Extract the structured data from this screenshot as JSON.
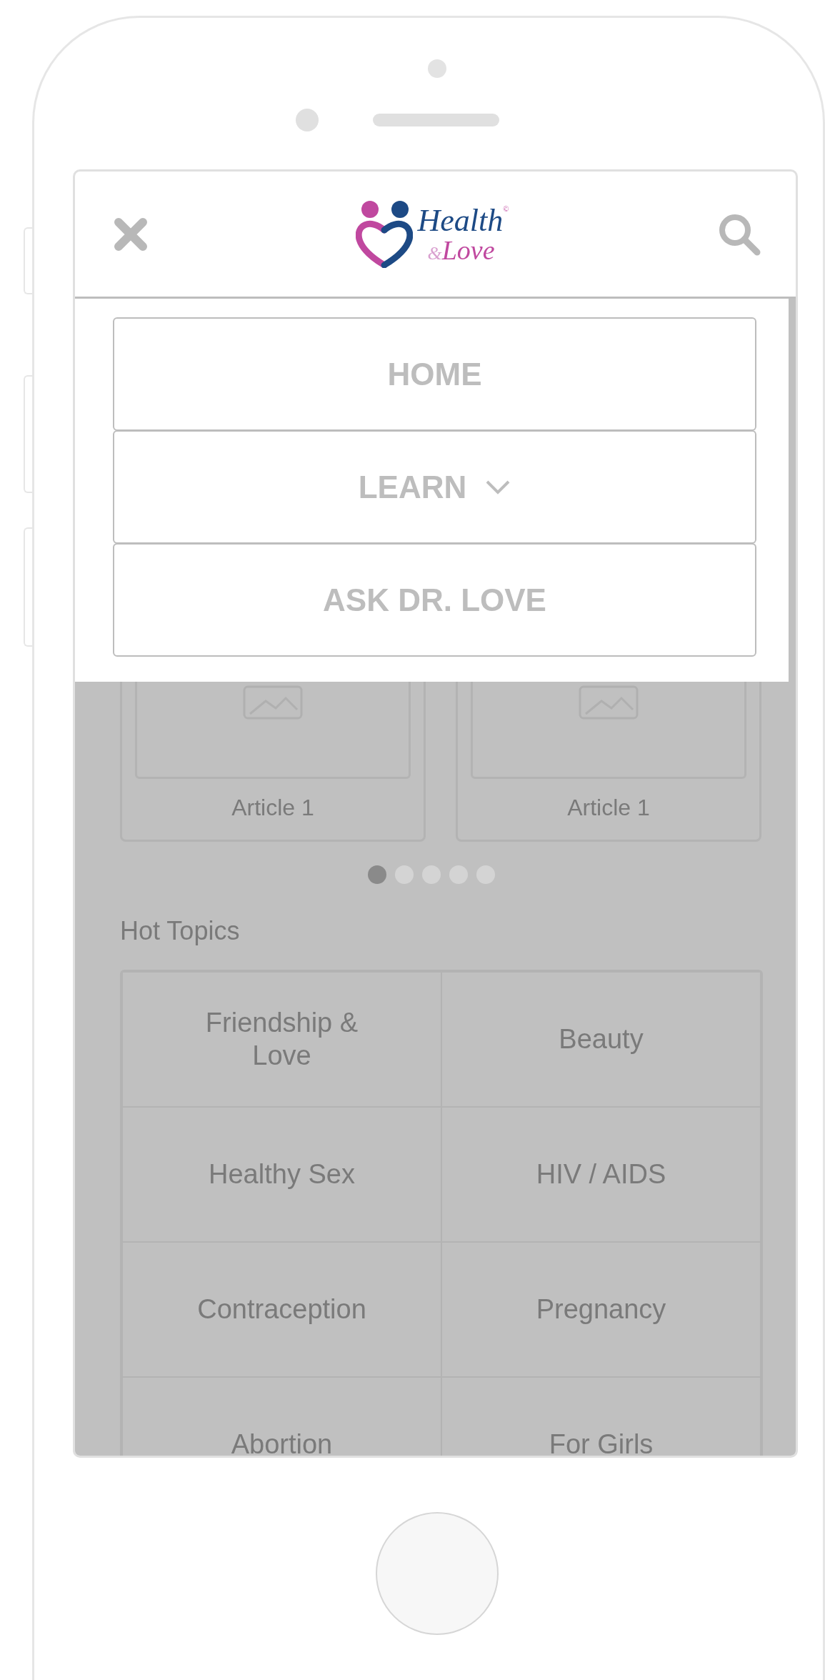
{
  "logo": {
    "title": "Health",
    "ampersand": "&",
    "subtitle": "Love",
    "mark": "©"
  },
  "menu": [
    {
      "label": "HOME",
      "kind": "link"
    },
    {
      "label": "LEARN",
      "kind": "dropdown",
      "expanded": false
    },
    {
      "label": "ASK DR. LOVE",
      "kind": "link"
    }
  ],
  "articles": [
    {
      "title": "Article 1"
    },
    {
      "title": "Article 1"
    }
  ],
  "carousel_dots": [
    {
      "selected": true
    },
    {
      "selected": false
    },
    {
      "selected": false
    },
    {
      "selected": false
    },
    {
      "selected": false
    }
  ],
  "hot_topics": {
    "heading": "Hot Topics",
    "topics": [
      "Friendship & Love",
      "Beauty",
      "Healthy Sex",
      "HIV / AIDS",
      "Contraception",
      "Pregnancy",
      "Abortion",
      "For Girls"
    ]
  }
}
